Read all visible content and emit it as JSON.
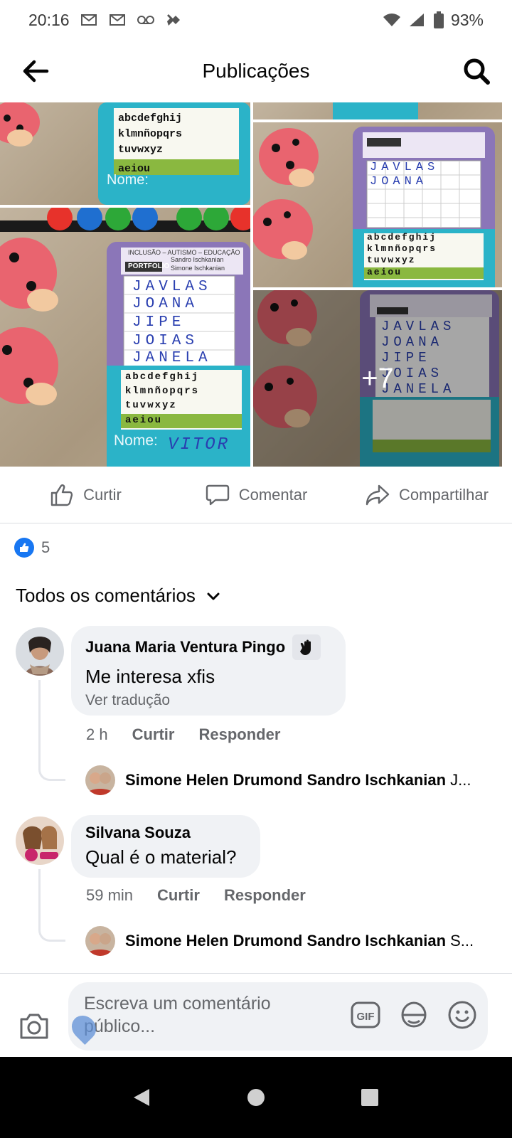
{
  "status_bar": {
    "time": "20:16",
    "battery": "93%",
    "icons": [
      "gmail-icon",
      "gmail-icon",
      "voicemail-icon",
      "app-icon",
      "wifi-icon",
      "signal-icon",
      "battery-icon"
    ]
  },
  "header": {
    "title": "Publicações",
    "back_icon": "arrow-left-icon",
    "search_icon": "search-icon"
  },
  "photos": {
    "more_count": "+7",
    "boards": [
      {
        "words": [],
        "name_label": "Nome:"
      },
      {
        "words": [
          "JAVLAS",
          "JOANA"
        ],
        "name_label": ""
      },
      {
        "words": [
          "JAVLAS",
          "JOANA",
          "JIPE",
          "JOIAS",
          "JANELA"
        ],
        "name_label": "Nome:",
        "name_value": "VITOR"
      },
      {
        "words": [
          "JAVLAS",
          "JOANA",
          "JIPE",
          "JOIAS",
          "JANELA"
        ],
        "name_label": ""
      }
    ],
    "board_header": "INCLUSÃO – AUTISMO – EDUCAÇÃO",
    "board_brand": "PORTFOLIO",
    "board_authors": [
      "Sandro Ischkanian",
      "Simone Ischkanian"
    ],
    "alphabet_rows": [
      "abcdefghij",
      "klmnñopqrs",
      "tuvwxyz",
      "aeiou"
    ]
  },
  "actions": {
    "like": "Curtir",
    "comment": "Comentar",
    "share": "Compartilhar"
  },
  "reactions": {
    "count": "5"
  },
  "filter": {
    "label": "Todos os comentários"
  },
  "comments": [
    {
      "author": "Juana Maria Ventura Pingo",
      "badge_icon": "wave-hand-icon",
      "text": "Me interesa xfis",
      "translate": "Ver tradução",
      "time": "2 h",
      "like": "Curtir",
      "reply": "Responder",
      "reply_preview": {
        "name": "Simone Helen Drumond Sandro Ischkanian",
        "rest": "J..."
      }
    },
    {
      "author": "Silvana Souza",
      "text": "Qual é o material?",
      "time": "59 min",
      "like": "Curtir",
      "reply": "Responder",
      "reply_preview": {
        "name": "Simone Helen Drumond Sandro Ischkanian",
        "rest": "S..."
      }
    }
  ],
  "composer": {
    "placeholder": "Escreva um comentário público...",
    "placeholder_line1": "Escreva um comentário",
    "placeholder_line2": "público...",
    "gif_label": "GIF"
  },
  "colors": {
    "facebook_blue": "#1877f2",
    "gray_text": "#65676b",
    "bubble_bg": "#f0f2f5",
    "board_teal": "#2bb3c8",
    "board_purple": "#8b76b8",
    "ladybug_red": "#e9646f"
  }
}
